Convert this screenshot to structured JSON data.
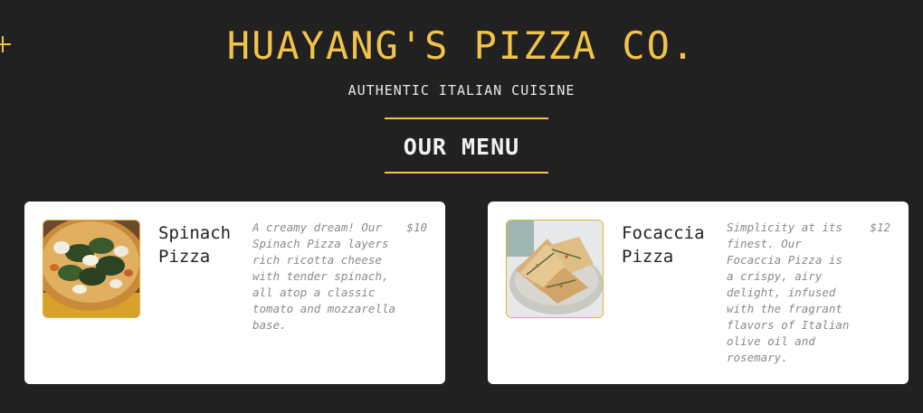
{
  "header": {
    "title": "HUAYANG'S PIZZA CO.",
    "tagline": "AUTHENTIC ITALIAN CUISINE"
  },
  "menu": {
    "heading": "OUR MENU",
    "items": [
      {
        "name": "Spinach Pizza",
        "description": "A creamy dream! Our Spinach Pizza layers rich ricotta cheese with tender spinach, all atop a classic tomato and mozzarella base.",
        "price": "$10",
        "image_icon": "spinach-pizza-photo"
      },
      {
        "name": "Focaccia Pizza",
        "description": "Simplicity at its finest. Our Focaccia Pizza is a crispy, airy delight, infused with the fragrant flavors of Italian olive oil and rosemary.",
        "price": "$12",
        "image_icon": "focaccia-pizza-photo"
      }
    ]
  },
  "colors": {
    "background": "#212121",
    "accent": "#f2c34a",
    "card": "#ffffff"
  }
}
